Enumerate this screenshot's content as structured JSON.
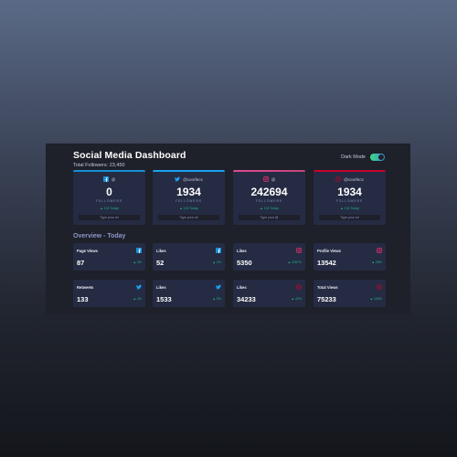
{
  "header": {
    "title": "Social Media Dashboard",
    "subtitle": "Total Followers: 23,450",
    "mode_label": "Dark Mode"
  },
  "cards": [
    {
      "network": "facebook",
      "handle": "@",
      "count": "0",
      "label": "FOLLOWERS",
      "today": "▲ 132 Today",
      "url_placeholder": "Type your url",
      "color": "#178fd5"
    },
    {
      "network": "twitter",
      "handle": "@coorfecs",
      "count": "1934",
      "label": "FOLLOWERS",
      "today": "▲ 132 Today",
      "url_placeholder": "Type your url",
      "color": "#1ca0f2"
    },
    {
      "network": "instagram",
      "handle": "@",
      "count": "242694",
      "label": "FOLLOWERS",
      "today": "▲ 132 Today",
      "url_placeholder": "Type your @",
      "color": "#c4467c"
    },
    {
      "network": "youtube",
      "handle": "@coorfecs",
      "count": "1934",
      "label": "FOLLOWERS",
      "today": "▲ 132 Today",
      "url_placeholder": "Type your url",
      "color": "#c4032b"
    }
  ],
  "overview": {
    "title": "Overview - Today",
    "items": [
      {
        "label": "Page Views",
        "value": "87",
        "change": "▲ 3%",
        "icon": "facebook-icon"
      },
      {
        "label": "Likes",
        "value": "52",
        "change": "▲ 2%",
        "icon": "facebook-icon"
      },
      {
        "label": "Likes",
        "value": "5350",
        "change": "▲ 2257%",
        "icon": "instagram-icon"
      },
      {
        "label": "Profile Views",
        "value": "13542",
        "change": "▲ 28%",
        "icon": "instagram-icon"
      },
      {
        "label": "Retweets",
        "value": "133",
        "change": "▲ 4%",
        "icon": "twitter-icon"
      },
      {
        "label": "Likes",
        "value": "1533",
        "change": "▲ 5%",
        "icon": "twitter-icon"
      },
      {
        "label": "Likes",
        "value": "34233",
        "change": "▲ 42%",
        "icon": "youtube-icon"
      },
      {
        "label": "Total Views",
        "value": "75233",
        "change": "▲ 105%",
        "icon": "youtube-icon"
      }
    ]
  }
}
